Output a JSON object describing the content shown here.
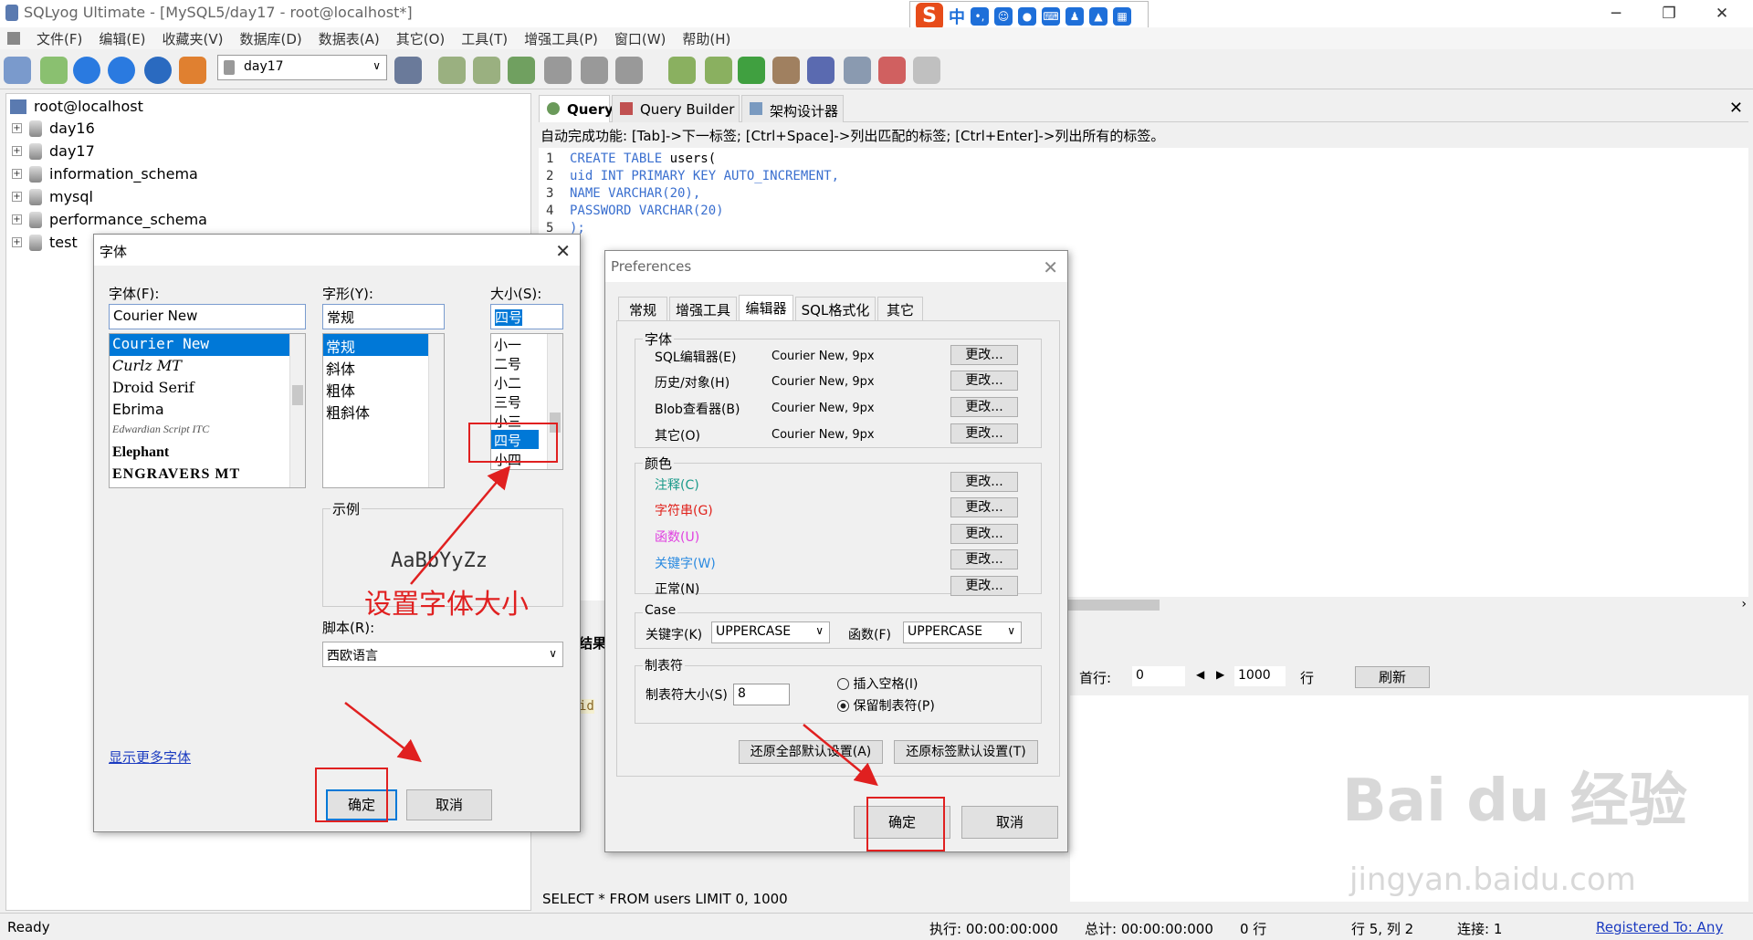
{
  "app": {
    "title": "SQLyog Ultimate - [MySQL5/day17 - root@localhost*]"
  },
  "menu": [
    "文件(F)",
    "编辑(E)",
    "收藏夹(V)",
    "数据库(D)",
    "数据表(A)",
    "其它(O)",
    "工具(T)",
    "增强工具(P)",
    "窗口(W)",
    "帮助(H)"
  ],
  "toolbar": {
    "db_selector": "day17"
  },
  "ime": {
    "s_label": "S",
    "lang": "中"
  },
  "tree": {
    "root": "root@localhost",
    "items": [
      "day16",
      "day17",
      "information_schema",
      "mysql",
      "performance_schema",
      "test"
    ]
  },
  "tabs": [
    "Query",
    "Query Builder",
    "架构设计器"
  ],
  "editor": {
    "hint": "自动完成功能: [Tab]->下一标签; [Ctrl+Space]->列出匹配的标签; [Ctrl+Enter]->列出所有的标签。",
    "lines": [
      {
        "n": "1",
        "a": "CREATE TABLE",
        "b": " users("
      },
      {
        "n": "2",
        "a": "uid INT PRIMARY KEY AUTO_INCREMENT,",
        "b": ""
      },
      {
        "n": "3",
        "a": "NAME VARCHAR(20),",
        "b": ""
      },
      {
        "n": "4",
        "a": "PASSWORD VARCHAR(20)",
        "b": ""
      },
      {
        "n": "5",
        "a": ");",
        "b": ""
      }
    ]
  },
  "results": {
    "title": "结果",
    "col": "id",
    "first_row_label": "首行:",
    "first_row_value": "0",
    "rows_value": "1000",
    "rows_label": "行",
    "refresh": "刷新"
  },
  "sql_line": "SELECT * FROM users LIMIT 0, 1000",
  "status": {
    "ready": "Ready",
    "exec": "执行: 00:00:00:000",
    "total": "总计: 00:00:00:000",
    "rows": "0 行",
    "pos": "行 5, 列 2",
    "conn": "连接: 1",
    "reg": "Registered To: Any"
  },
  "font_dialog": {
    "title": "字体",
    "font_label": "字体(F):",
    "font_value": "Courier New",
    "fonts": [
      "Courier New",
      "Curlz MT",
      "Droid Serif",
      "Ebrima",
      "Edwardian Script ITC",
      "Elephant",
      "ENGRAVERS MT"
    ],
    "style_label": "字形(Y):",
    "style_value": "常规",
    "styles": [
      "常规",
      "斜体",
      "粗体",
      "粗斜体"
    ],
    "size_label": "大小(S):",
    "size_value": "四号",
    "sizes": [
      "小一",
      "二号",
      "小二",
      "三号",
      "小三",
      "四号",
      "小四"
    ],
    "sample_label": "示例",
    "sample_text": "AaBbYyZz",
    "script_label": "脚本(R):",
    "script_value": "西欧语言",
    "more_fonts": "显示更多字体",
    "ok": "确定",
    "cancel": "取消"
  },
  "annotation": "设置字体大小",
  "prefs": {
    "title": "Preferences",
    "tabs": [
      "常规",
      "增强工具",
      "编辑器",
      "SQL格式化",
      "其它"
    ],
    "font_group": "字体",
    "font_rows": [
      {
        "label": "SQL编辑器(E)",
        "value": "Courier New, 9px",
        "btn": "更改..."
      },
      {
        "label": "历史/对象(H)",
        "value": "Courier New, 9px",
        "btn": "更改..."
      },
      {
        "label": "Blob查看器(B)",
        "value": "Courier New, 9px",
        "btn": "更改..."
      },
      {
        "label": "其它(O)",
        "value": "Courier New, 9px",
        "btn": "更改..."
      }
    ],
    "color_group": "颜色",
    "color_rows": [
      {
        "label": "注释(C)",
        "color": "#1a9a8a",
        "btn": "更改..."
      },
      {
        "label": "字符串(G)",
        "color": "#e0201a",
        "btn": "更改..."
      },
      {
        "label": "函数(U)",
        "color": "#e040e0",
        "btn": "更改..."
      },
      {
        "label": "关键字(W)",
        "color": "#2a8ae0",
        "btn": "更改..."
      },
      {
        "label": "正常(N)",
        "color": "#000000",
        "btn": "更改..."
      }
    ],
    "case_group": "Case",
    "keyword_label": "关键字(K)",
    "keyword_value": "UPPERCASE",
    "func_label": "函数(F)",
    "func_value": "UPPERCASE",
    "tab_group": "制表符",
    "tab_size_label": "制表符大小(S)",
    "tab_size_value": "8",
    "insert_spaces": "插入空格(I)",
    "keep_tabs": "保留制表符(P)",
    "restore_all": "还原全部默认设置(A)",
    "restore_tab": "还原标签默认设置(T)",
    "ok": "确定",
    "cancel": "取消"
  },
  "watermark": {
    "main": "Bai du 经验",
    "sub": "jingyan.baidu.com"
  }
}
